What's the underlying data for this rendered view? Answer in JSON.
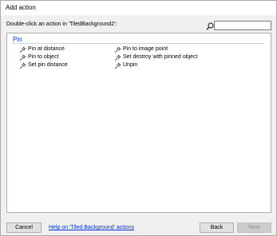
{
  "window": {
    "title": "Add action"
  },
  "prompt": "Double-click an action in 'TiledBackground2':",
  "search": {
    "value": "",
    "placeholder": ""
  },
  "group": {
    "name": "Pin",
    "color": "#0033cc"
  },
  "actions": {
    "col1": [
      "Pin at distance",
      "Pin to object",
      "Set pin distance"
    ],
    "col2": [
      "Pin to image point",
      "Set destroy with pinned object",
      "Unpin"
    ]
  },
  "footer": {
    "cancel_label": "Cancel",
    "help_link": "Help on 'Tiled Background' actions",
    "back_label": "Back",
    "next_label": "Next"
  },
  "colors": {
    "link": "#0033cc",
    "panel_border": "#adadad",
    "disabled_text": "#8c8c8c"
  }
}
